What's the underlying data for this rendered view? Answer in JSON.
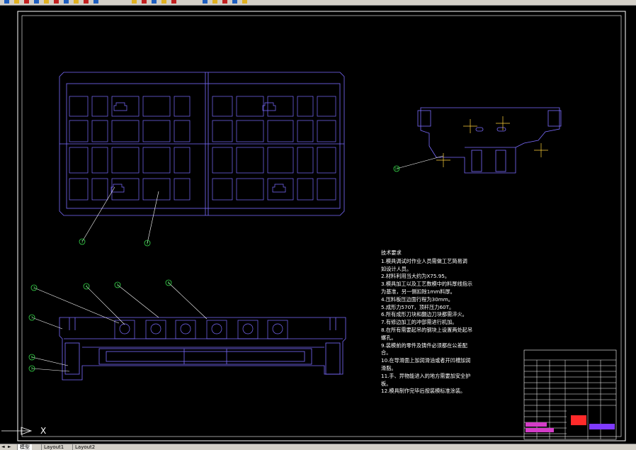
{
  "toolbar": {
    "icons": [
      "open-icon",
      "save-icon",
      "print-icon",
      "preview-icon",
      "cut-icon",
      "copy-icon",
      "paste-icon",
      "match-icon",
      "undo-icon",
      "redo-icon",
      "pan-icon",
      "zoom-icon",
      "zoom-window-icon",
      "zoom-prev-icon",
      "properties-icon",
      "designcenter-icon",
      "toolpalette-icon",
      "markup-icon",
      "calc-icon",
      "help-icon"
    ],
    "colors": {
      "bg": "#d4d0c8",
      "icon_blue": "#1f5fbf",
      "icon_yellow": "#e0b020",
      "icon_red": "#c02020"
    }
  },
  "drawing": {
    "frame_color": "#ffffff",
    "part_color": "#7b6cff",
    "leader_color": "#ffffff",
    "bubble_color": "#36d94a",
    "crosshair_color": "#ffd23a",
    "balloons": [
      "1",
      "2",
      "3",
      "4",
      "5",
      "6",
      "7",
      "8",
      "9",
      "10",
      "11"
    ],
    "technical_requirements": {
      "heading": "技术要求",
      "lines": [
        "1.模具调试时作业人员需做工艺简易调",
        "如设计人员。",
        "2.材料利用当大约为X75.95。",
        "3.模具加工以及工艺数模中的料厚线指示",
        "为基准，另一侧扣除1mm料厚。",
        "4.压料板压边面行程为30mm。",
        "5.成形力570T，顶杆压力60T。",
        "6.所有成形刀块和翻边刀块都需淬火。",
        "7.有修边加工的冲部需进行机加。",
        "8.在所有需要起吊的钢块上设置两处起吊",
        "螺孔。",
        "9.装模前的零件及铸件必须都在公差配",
        "合。",
        "10.在导滑面上加润滑油或者开凹槽加润",
        "滑脂。",
        "11.手、异物能进入的地方需要加安全护",
        "板。",
        "12.模具制作完毕后按装模标准涂装。"
      ]
    }
  },
  "layout_tabs": {
    "nav": [
      "◄",
      "►"
    ],
    "tabs": [
      "模型",
      "Layout1",
      "Layout2"
    ],
    "active": 0
  },
  "ucs": {
    "x_label": "X"
  }
}
